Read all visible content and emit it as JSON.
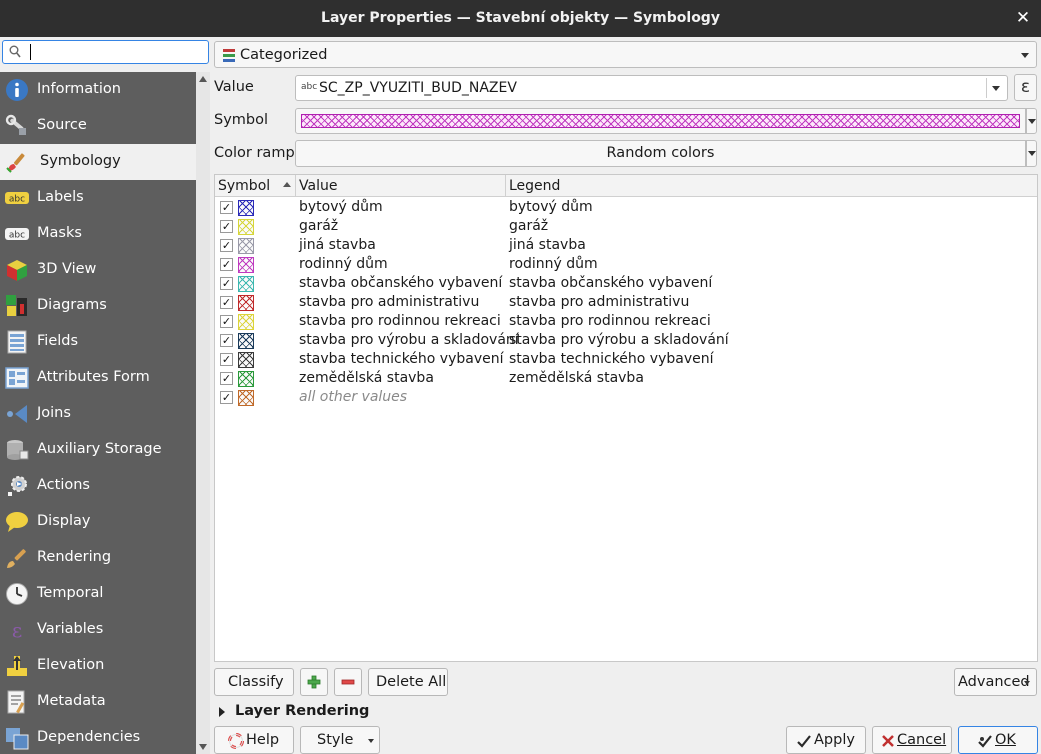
{
  "window": {
    "title": "Layer Properties — Stavební objekty — Symbology",
    "close_glyph": "✕"
  },
  "sidebar": {
    "search_placeholder": "",
    "items": [
      {
        "label": "Information",
        "icon": "info-icon"
      },
      {
        "label": "Source",
        "icon": "source-wrench-icon"
      },
      {
        "label": "Symbology",
        "icon": "paintbrush-icon",
        "active": true
      },
      {
        "label": "Labels",
        "icon": "labels-abc-icon"
      },
      {
        "label": "Masks",
        "icon": "masks-abc-icon"
      },
      {
        "label": "3D View",
        "icon": "cube-3d-icon"
      },
      {
        "label": "Diagrams",
        "icon": "diagrams-icon"
      },
      {
        "label": "Fields",
        "icon": "fields-icon"
      },
      {
        "label": "Attributes Form",
        "icon": "attributes-form-icon"
      },
      {
        "label": "Joins",
        "icon": "joins-icon"
      },
      {
        "label": "Auxiliary Storage",
        "icon": "auxiliary-storage-icon"
      },
      {
        "label": "Actions",
        "icon": "actions-gear-icon"
      },
      {
        "label": "Display",
        "icon": "display-speech-icon"
      },
      {
        "label": "Rendering",
        "icon": "rendering-brush-icon"
      },
      {
        "label": "Temporal",
        "icon": "clock-icon"
      },
      {
        "label": "Variables",
        "icon": "epsilon-icon"
      },
      {
        "label": "Elevation",
        "icon": "elevation-icon"
      },
      {
        "label": "Metadata",
        "icon": "metadata-icon"
      },
      {
        "label": "Dependencies",
        "icon": "dependencies-icon"
      }
    ]
  },
  "renderer": {
    "selected": "Categorized"
  },
  "form": {
    "value_label": "Value",
    "value_type": "abc",
    "value_field": "SC_ZP_VYUZITI_BUD_NAZEV",
    "expression_glyph": "ε",
    "symbol_label": "Symbol",
    "color_ramp_label": "Color ramp",
    "color_ramp_value": "Random colors"
  },
  "table": {
    "headers": {
      "symbol": "Symbol",
      "value": "Value",
      "legend": "Legend"
    },
    "rows": [
      {
        "value": "bytový dům",
        "legend": "bytový dům",
        "color": "#2a2ab8",
        "checked": true
      },
      {
        "value": "garáž",
        "legend": "garáž",
        "color": "#d6d63a",
        "checked": true
      },
      {
        "value": "jiná stavba",
        "legend": "jiná stavba",
        "color": "#9a9aa8",
        "checked": true
      },
      {
        "value": "rodinný dům",
        "legend": "rodinný dům",
        "color": "#c03ac0",
        "checked": true
      },
      {
        "value": "stavba občanského vybavení",
        "legend": "stavba občanského vybavení",
        "color": "#3cb8b0",
        "checked": true
      },
      {
        "value": "stavba pro administrativu",
        "legend": "stavba pro administrativu",
        "color": "#c02a2a",
        "checked": true
      },
      {
        "value": "stavba pro rodinnou rekreaci",
        "legend": "stavba pro rodinnou rekreaci",
        "color": "#dcd43a",
        "checked": true
      },
      {
        "value": "stavba pro výrobu a skladování",
        "legend": "stavba pro výrobu a skladování",
        "color": "#1a3a5a",
        "checked": true
      },
      {
        "value": "stavba technického vybavení",
        "legend": "stavba technického vybavení",
        "color": "#3a3a3a",
        "checked": true
      },
      {
        "value": "zemědělská stavba",
        "legend": "zemědělská stavba",
        "color": "#2a9a3a",
        "checked": true
      },
      {
        "value": "all other values",
        "legend": "",
        "color": "#c06a2a",
        "checked": true,
        "other": true
      }
    ]
  },
  "buttons": {
    "classify": "Classify",
    "delete_all": "Delete All",
    "advanced": "Advanced",
    "layer_rendering": "Layer Rendering",
    "help": "Help",
    "style": "Style",
    "apply": "Apply",
    "cancel": "Cancel",
    "ok": "OK"
  },
  "colors": {
    "accent": "#3584e4",
    "sidebar_bg": "#5e5e5e",
    "titlebar_bg": "#2f2f2f"
  }
}
